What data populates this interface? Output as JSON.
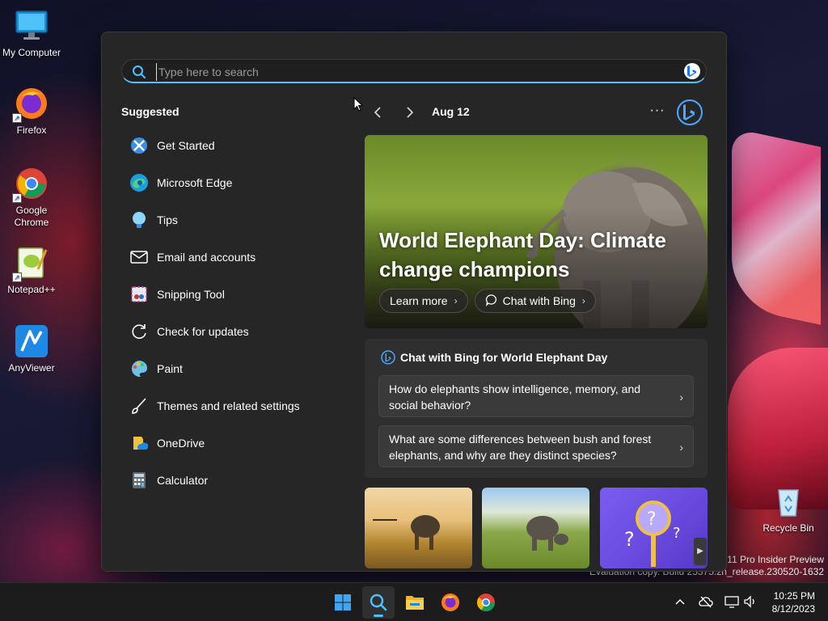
{
  "desktop": {
    "icons": [
      {
        "label": "My Computer"
      },
      {
        "label": "Firefox"
      },
      {
        "label": "Google Chrome"
      },
      {
        "label": "Notepad++"
      },
      {
        "label": "AnyViewer"
      },
      {
        "label": "Recycle Bin"
      }
    ],
    "watermark_line1": "s 11 Pro Insider Preview",
    "watermark_line2": "Evaluation copy. Build 25375.zn_release.230520-1632"
  },
  "search": {
    "placeholder": "Type here to search",
    "value": ""
  },
  "suggested": {
    "title": "Suggested",
    "items": [
      {
        "label": "Get Started",
        "icon": "get-started-icon"
      },
      {
        "label": "Microsoft Edge",
        "icon": "edge-icon"
      },
      {
        "label": "Tips",
        "icon": "tips-icon"
      },
      {
        "label": "Email and accounts",
        "icon": "mail-icon"
      },
      {
        "label": "Snipping Tool",
        "icon": "snipping-tool-icon"
      },
      {
        "label": "Check for updates",
        "icon": "refresh-icon"
      },
      {
        "label": "Paint",
        "icon": "paint-icon"
      },
      {
        "label": "Themes and related settings",
        "icon": "brush-icon"
      },
      {
        "label": "OneDrive",
        "icon": "onedrive-icon"
      },
      {
        "label": "Calculator",
        "icon": "calculator-icon"
      }
    ]
  },
  "highlights": {
    "date": "Aug 12",
    "more": "···",
    "hero": {
      "title": "World Elephant Day: Climate change champions",
      "learn_more": "Learn more",
      "chat_with_bing": "Chat with Bing"
    },
    "chat_card": {
      "title": "Chat with Bing for World Elephant Day",
      "questions": [
        "How do elephants show intelligence, memory, and social behavior?",
        "What are some differences between bush and forest elephants, and why are they distinct species?"
      ]
    }
  },
  "taskbar": {
    "time": "10:25 PM",
    "date": "8/12/2023"
  },
  "colors": {
    "accent": "#4cc2ff",
    "panel_bg": "#262626",
    "card_bg": "#2f2f2f"
  }
}
